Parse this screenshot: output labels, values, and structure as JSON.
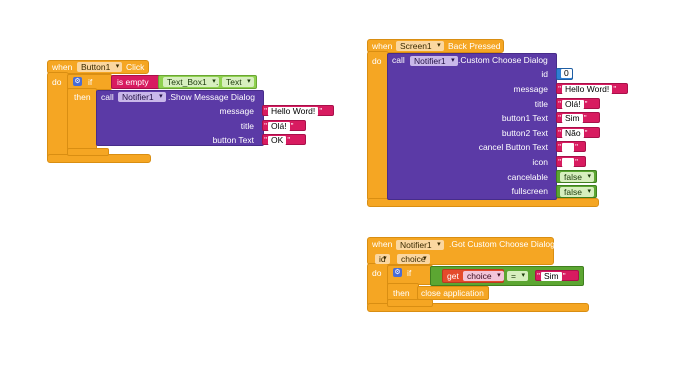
{
  "block1": {
    "when": "when",
    "component": "Button1",
    "event": "Click",
    "do": "do",
    "if": "if",
    "then": "then",
    "is_empty": "is empty",
    "textbox": "Text_Box1",
    "text_prop": "Text",
    "call": "call",
    "notifier": "Notifier1",
    "method": "Show Message Dialog",
    "args": [
      {
        "label": "message",
        "value": "Hello Word!"
      },
      {
        "label": "title",
        "value": "Olá!"
      },
      {
        "label": "button Text",
        "value": "OK"
      }
    ]
  },
  "block2": {
    "when": "when",
    "component": "Screen1",
    "event": "Back Pressed",
    "do": "do",
    "call": "call",
    "notifier": "Notifier1",
    "method": "Custom Choose Dialog",
    "id_label": "id",
    "id_value": "0",
    "args": [
      {
        "label": "message",
        "value": "Hello Word!"
      },
      {
        "label": "title",
        "value": "Olá!"
      },
      {
        "label": "button1 Text",
        "value": "Sim"
      },
      {
        "label": "button2 Text",
        "value": "Não"
      },
      {
        "label": "cancel Button Text",
        "value": ""
      },
      {
        "label": "icon",
        "value": ""
      }
    ],
    "cancelable_label": "cancelable",
    "cancelable_value": "false",
    "fullscreen_label": "fullscreen",
    "fullscreen_value": "false"
  },
  "block3": {
    "when": "when",
    "component": "Notifier1",
    "event": "Got Custom Choose Dialog",
    "param_id": "id",
    "param_choice": "choice",
    "do": "do",
    "if": "if",
    "then": "then",
    "get": "get",
    "get_var": "choice",
    "op": "=",
    "compare_value": "Sim",
    "action": "close application"
  },
  "colors": {
    "event": "#f5a623",
    "procedure": "#5b3aa6",
    "text": "#d81b60",
    "logic": "#5ca632",
    "component": "#8fd14f",
    "math": "#2f7fd4",
    "variable": "#e44a2b"
  }
}
